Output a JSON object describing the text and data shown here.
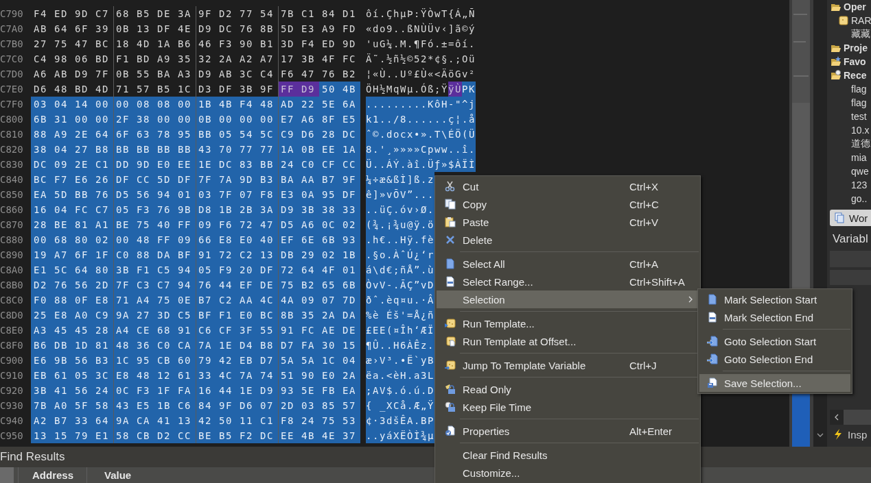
{
  "hex_editor": {
    "rows": [
      {
        "address": "C790",
        "segments": [
          {
            "hex": "F4 ED 9D C7 68 B5 DE 3A 9F D2 77 54 7B C1 84 D1",
            "ascii": "ôí.ÇhµÞ:ŸÒwT{Á„Ñ",
            "selected": false,
            "marked": false
          }
        ]
      },
      {
        "address": "C7A0",
        "segments": [
          {
            "hex": "AB 64 6F 39 0B 13 DF 4E D9 DC 76 8B 5D E3 A9 FD",
            "ascii": "«do9..ßNÙÜv‹]ã©ý",
            "selected": false,
            "marked": false
          }
        ]
      },
      {
        "address": "C7B0",
        "segments": [
          {
            "hex": "27 75 47 BC 18 4D 1A B6 46 F3 90 B1 3D F4 ED 9D",
            "ascii": "'uG¼.M.¶Fó.±=ôí.",
            "selected": false,
            "marked": false
          }
        ]
      },
      {
        "address": "C7C0",
        "segments": [
          {
            "hex": "C4 98 06 BD F1 BD A9 35 32 2A A2 A7 17 3B 4F FC",
            "ascii": "Ä˜.½ñ½©52*¢§.;Oü",
            "selected": false,
            "marked": false
          }
        ]
      },
      {
        "address": "C7D0",
        "segments": [
          {
            "hex": "A6 AB D9 7F 0B 55 BA A3 D9 AB 3C C4 F6 47 76 B2",
            "ascii": "¦«Ù..Uº£Ù«<ÄöGv²",
            "selected": false,
            "marked": false
          }
        ]
      },
      {
        "address": "C7E0",
        "segments": [
          {
            "hex": "D6 48 BD 4D 71 57 B5 1C D3 DF 3B 9F",
            "ascii": "ÖH½MqWµ.Óß;Ÿ",
            "selected": false,
            "marked": false
          },
          {
            "hex": "FF D9",
            "ascii": "ÿÙ",
            "selected": false,
            "marked": true
          },
          {
            "hex": "50 4B",
            "ascii": "PK",
            "selected": true,
            "marked": false
          }
        ]
      },
      {
        "address": "C7F0",
        "segments": [
          {
            "hex": "03 04 14 00 00 08 08 00 1B 4B F4 48 AD 22 5E 6A",
            "ascii": ".........KôH-\"^j",
            "selected": true,
            "marked": false
          }
        ]
      },
      {
        "address": "C800",
        "segments": [
          {
            "hex": "6B 31 00 00 2F 38 00 00 0B 00 00 00 E7 A6 8F E5",
            "ascii": "k1../8......ç¦.å",
            "selected": true,
            "marked": false
          }
        ]
      },
      {
        "address": "C810",
        "segments": [
          {
            "hex": "88 A9 2E 64 6F 63 78 95 BB 05 54 5C C9 D6 28 DC",
            "ascii": "ˆ©.docx•».T\\ÉÖ(Ü",
            "selected": true,
            "marked": false
          }
        ]
      },
      {
        "address": "C820",
        "segments": [
          {
            "hex": "38 04 27 B8 BB BB BB BB 43 70 77 77 1A 0B EE 1A",
            "ascii": "8.'¸»»»»Cpww..î.",
            "selected": true,
            "marked": false
          }
        ]
      },
      {
        "address": "C830",
        "segments": [
          {
            "hex": "DC 09 2E C1 DD 9D E0 EE 1E DC 83 BB 24 C0 CF CC",
            "ascii": "Ü..ÁÝ.àî.Üƒ»$ÀÏÌ",
            "selected": true,
            "marked": false
          }
        ]
      },
      {
        "address": "C840",
        "segments": [
          {
            "hex": "BC F7 E6 26 DF CC 5D DF 7F 7A 9D B3 BA AA B7 9F",
            "ascii": "¼÷æ&ßÌ]ß.z",
            "selected": true,
            "marked": false
          }
        ]
      },
      {
        "address": "C850",
        "segments": [
          {
            "hex": "EA 5D BB 76 D5 56 94 01 03 7F 07 F8 E3 0A 95 DF",
            "ascii": "ê]»vÕV”...",
            "selected": true,
            "marked": false
          }
        ]
      },
      {
        "address": "C860",
        "segments": [
          {
            "hex": "16 04 FC C7 05 F3 76 9B D8 1B 2B 3A D9 3B 38 33",
            "ascii": "..üÇ.óv›Ø.",
            "selected": true,
            "marked": false
          }
        ]
      },
      {
        "address": "C870",
        "segments": [
          {
            "hex": "28 BE 81 A1 BE 75 40 FF 09 F6 72 47 D5 A6 0C 02",
            "ascii": "(¾.¡¾u@ÿ.ö",
            "selected": true,
            "marked": false
          }
        ]
      },
      {
        "address": "C880",
        "segments": [
          {
            "hex": "00 68 80 02 00 48 FF 09 66 E8 E0 40 EF 6E 6B 93",
            "ascii": ".h€..Hÿ.fè",
            "selected": true,
            "marked": false
          }
        ]
      },
      {
        "address": "C890",
        "segments": [
          {
            "hex": "19 A7 6F 1F C0 88 DA BF 91 72 C2 13 DB 29 02 1B",
            "ascii": ".§o.ÀˆÚ¿‘r",
            "selected": true,
            "marked": false
          }
        ]
      },
      {
        "address": "C8A0",
        "segments": [
          {
            "hex": "E1 5C 64 80 3B F1 C5 94 05 F9 20 DF 72 64 4F 01",
            "ascii": "á\\d€;ñÅ”.ù",
            "selected": true,
            "marked": false
          }
        ]
      },
      {
        "address": "C8B0",
        "segments": [
          {
            "hex": "D2 76 56 2D 7F C3 C7 94 76 44 EF DE 75 B2 65 6B",
            "ascii": "ÒvV-.ÃÇ”vD",
            "selected": true,
            "marked": false
          }
        ]
      },
      {
        "address": "C8C0",
        "segments": [
          {
            "hex": "F0 88 0F E8 71 A4 75 0E B7 C2 AA 4C 4A 09 07 7D",
            "ascii": "ðˆ.èq¤u.·Â",
            "selected": true,
            "marked": false
          }
        ]
      },
      {
        "address": "C8D0",
        "segments": [
          {
            "hex": "25 E8 A0 C9 9A 27 3D C5 BF F1 E0 BC 8B 35 2A DA",
            "ascii": "%è Éš'=Å¿ñ",
            "selected": true,
            "marked": false
          }
        ]
      },
      {
        "address": "C8E0",
        "segments": [
          {
            "hex": "A3 45 45 28 A4 CE 68 91 C6 CF 3F 55 91 FC AE DE",
            "ascii": "£EE(¤Îh‘ÆÏ",
            "selected": true,
            "marked": false
          }
        ]
      },
      {
        "address": "C8F0",
        "segments": [
          {
            "hex": "B6 DB 1D 81 48 36 C0 CA 7A 1E D4 B8 D7 FA 30 15",
            "ascii": "¶Û..H6ÀÊz.",
            "selected": true,
            "marked": false
          }
        ]
      },
      {
        "address": "C900",
        "segments": [
          {
            "hex": "E6 9B 56 B3 1C 95 CB 60 79 42 EB D7 5A 5A 1C 04",
            "ascii": "æ›V³.•Ë`yB",
            "selected": true,
            "marked": false
          }
        ]
      },
      {
        "address": "C910",
        "segments": [
          {
            "hex": "EB 61 05 3C E8 48 12 61 33 4C 7A 74 51 90 E0 2A",
            "ascii": "ëa.<èH.a3L",
            "selected": true,
            "marked": false
          }
        ]
      },
      {
        "address": "C920",
        "segments": [
          {
            "hex": "3B 41 56 24 0C F3 1F FA 16 44 1E D9 93 5E FB EA",
            "ascii": ";AV$.ó.ú.D",
            "selected": true,
            "marked": false
          }
        ]
      },
      {
        "address": "C930",
        "segments": [
          {
            "hex": "7B A0 5F 58 43 E5 1B C6 84 9F D6 07 2D 03 85 57",
            "ascii": "{ _XCå.Æ„Ÿ",
            "selected": true,
            "marked": false
          }
        ]
      },
      {
        "address": "C940",
        "segments": [
          {
            "hex": "A2 B7 33 64 9A CA 41 13 42 50 11 C1 F8 24 75 53",
            "ascii": "¢·3dšÊA.BP",
            "selected": true,
            "marked": false
          }
        ]
      },
      {
        "address": "C950",
        "segments": [
          {
            "hex": "13 15 79 E1 58 CB D2 CC BE B5 F2 DC EE 4B 4E 37",
            "ascii": "..yáXËÒÌ¾µ",
            "selected": true,
            "marked": false
          }
        ]
      }
    ]
  },
  "context_menu": {
    "items": [
      {
        "kind": "item",
        "label": "Cut",
        "shortcut": "Ctrl+X",
        "selected": false
      },
      {
        "kind": "item",
        "label": "Copy",
        "shortcut": "Ctrl+C",
        "selected": false
      },
      {
        "kind": "item",
        "label": "Paste",
        "shortcut": "Ctrl+V",
        "selected": false
      },
      {
        "kind": "item",
        "label": "Delete",
        "selected": false
      },
      {
        "kind": "separator"
      },
      {
        "kind": "item",
        "label": "Select All",
        "shortcut": "Ctrl+A",
        "selected": false
      },
      {
        "kind": "item",
        "label": "Select Range...",
        "shortcut": "Ctrl+Shift+A",
        "selected": false
      },
      {
        "kind": "submenu",
        "label": "Selection",
        "selected": true
      },
      {
        "kind": "separator"
      },
      {
        "kind": "item",
        "label": "Run Template...",
        "selected": false
      },
      {
        "kind": "item",
        "label": "Run Template at Offset...",
        "selected": false
      },
      {
        "kind": "separator"
      },
      {
        "kind": "item",
        "label": "Jump To Template Variable",
        "shortcut": "Ctrl+J",
        "selected": false
      },
      {
        "kind": "separator"
      },
      {
        "kind": "item",
        "label": "Read Only",
        "selected": false
      },
      {
        "kind": "item",
        "label": "Keep File Time",
        "selected": false
      },
      {
        "kind": "separator"
      },
      {
        "kind": "item",
        "label": "Properties",
        "shortcut": "Alt+Enter",
        "selected": false
      },
      {
        "kind": "separator"
      },
      {
        "kind": "item",
        "label": "Clear Find Results",
        "selected": false
      },
      {
        "kind": "item",
        "label": "Customize...",
        "selected": false
      }
    ]
  },
  "submenu": {
    "items": [
      {
        "kind": "item",
        "label": "Mark Selection Start",
        "selected": false
      },
      {
        "kind": "item",
        "label": "Mark Selection End",
        "selected": false
      },
      {
        "kind": "separator"
      },
      {
        "kind": "item",
        "label": "Goto Selection Start",
        "selected": false
      },
      {
        "kind": "item",
        "label": "Goto Selection End",
        "selected": false
      },
      {
        "kind": "separator"
      },
      {
        "kind": "item",
        "label": "Save Selection...",
        "selected": true
      }
    ]
  },
  "side_panel": {
    "tree": [
      {
        "label": "Oper",
        "children": [
          {
            "label": "RAR"
          },
          {
            "label": "藏藏"
          }
        ]
      },
      {
        "label": "Proje"
      },
      {
        "label": "Favo"
      },
      {
        "label": "Rece",
        "children": [
          {
            "label": "flag"
          },
          {
            "label": "flag"
          },
          {
            "label": "test"
          },
          {
            "label": "10.x"
          },
          {
            "label": "道德"
          },
          {
            "label": "mia"
          },
          {
            "label": "qwe"
          },
          {
            "label": "123"
          },
          {
            "label": "go.."
          }
        ]
      }
    ],
    "tab": "Wor",
    "variables_title": "Variabl",
    "inspector_tab": "Insp"
  },
  "find_results": {
    "title": "Find Results",
    "columns": [
      "Address",
      "Value"
    ]
  }
}
